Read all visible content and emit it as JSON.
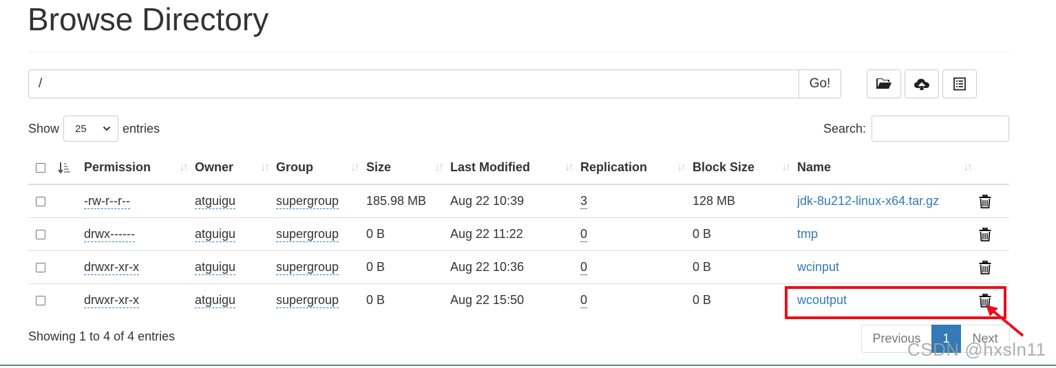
{
  "page": {
    "title": "Browse Directory"
  },
  "path_bar": {
    "value": "/",
    "go_label": "Go!"
  },
  "toolbar": {
    "icons": [
      "folder-open-icon",
      "cloud-upload-icon",
      "list-alt-icon"
    ]
  },
  "length_menu": {
    "show_label": "Show",
    "selected": "25",
    "entries_label": "entries"
  },
  "search": {
    "label": "Search:",
    "value": ""
  },
  "table": {
    "columns": [
      "Permission",
      "Owner",
      "Group",
      "Size",
      "Last Modified",
      "Replication",
      "Block Size",
      "Name"
    ],
    "rows": [
      {
        "permission": "-rw-r--r--",
        "owner": "atguigu",
        "group": "supergroup",
        "size": "185.98 MB",
        "modified": "Aug 22 10:39",
        "replication": "3",
        "block_size": "128 MB",
        "name": "jdk-8u212-linux-x64.tar.gz"
      },
      {
        "permission": "drwx------",
        "owner": "atguigu",
        "group": "supergroup",
        "size": "0 B",
        "modified": "Aug 22 11:22",
        "replication": "0",
        "block_size": "0 B",
        "name": "tmp"
      },
      {
        "permission": "drwxr-xr-x",
        "owner": "atguigu",
        "group": "supergroup",
        "size": "0 B",
        "modified": "Aug 22 10:36",
        "replication": "0",
        "block_size": "0 B",
        "name": "wcinput"
      },
      {
        "permission": "drwxr-xr-x",
        "owner": "atguigu",
        "group": "supergroup",
        "size": "0 B",
        "modified": "Aug 22 15:50",
        "replication": "0",
        "block_size": "0 B",
        "name": "wcoutput"
      }
    ]
  },
  "footer": {
    "info": "Showing 1 to 4 of 4 entries",
    "prev_label": "Previous",
    "page_label": "1",
    "next_label": "Next"
  },
  "watermark": "CSDN @hxsln11",
  "colors": {
    "link": "#337ab7",
    "highlight": "#e8101a",
    "active_page": "#337ab7"
  }
}
